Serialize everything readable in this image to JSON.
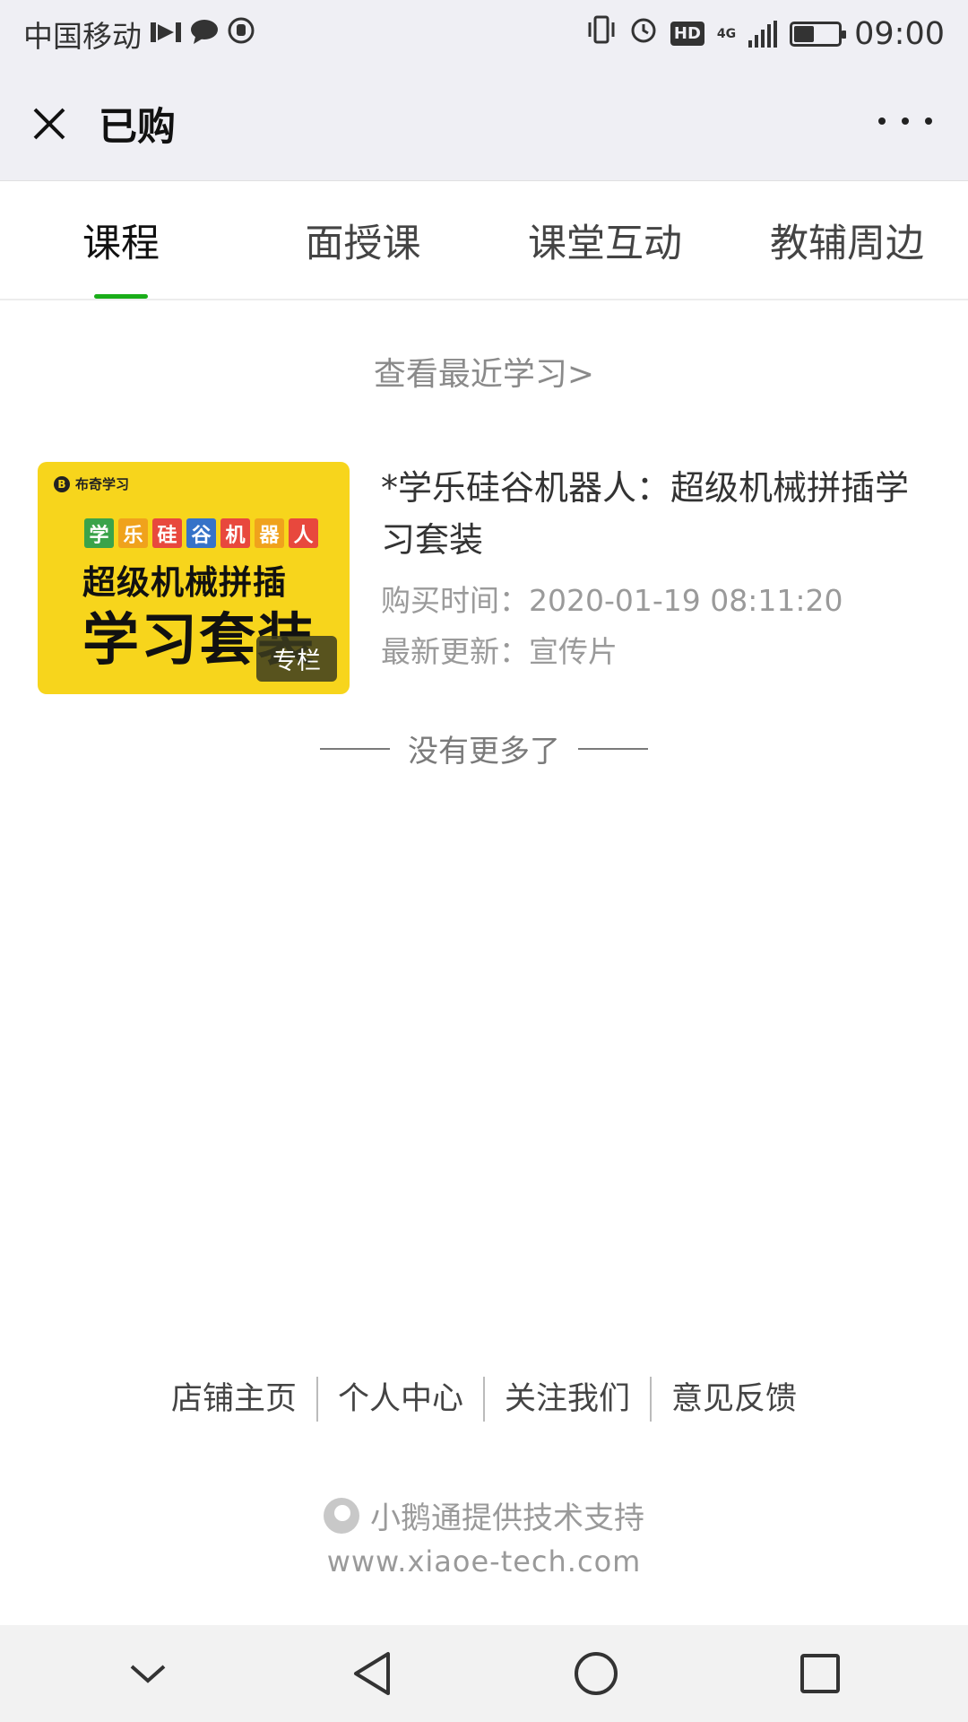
{
  "status": {
    "carrier": "中国移动",
    "time": "09:00",
    "network": "4G",
    "hd": "HD",
    "battery_percent": 45
  },
  "navbar": {
    "title": "已购"
  },
  "tabs": [
    {
      "label": "课程",
      "active": true
    },
    {
      "label": "面授课",
      "active": false
    },
    {
      "label": "课堂互动",
      "active": false
    },
    {
      "label": "教辅周边",
      "active": false
    }
  ],
  "recent_link": "查看最近学习>",
  "course": {
    "cover_logo": "布奇学习",
    "cover_blocks": [
      "学",
      "乐",
      "硅",
      "谷",
      "机",
      "器",
      "人"
    ],
    "cover_line1": "超级机械拼插",
    "cover_line2": "学习套装",
    "badge": "专栏",
    "title": "*学乐硅谷机器人：超级机械拼插学习套装",
    "purchase_time": "购买时间：2020-01-19 08:11:20",
    "latest_update": "最新更新：宣传片"
  },
  "no_more": "没有更多了",
  "footer": {
    "links": [
      "店铺主页",
      "个人中心",
      "关注我们",
      "意见反馈"
    ],
    "powered_by": "小鹅通提供技术支持",
    "website": "www.xiaoe-tech.com"
  },
  "colors": {
    "accent": "#1aad19",
    "cover_bg": "#f7d51c"
  }
}
